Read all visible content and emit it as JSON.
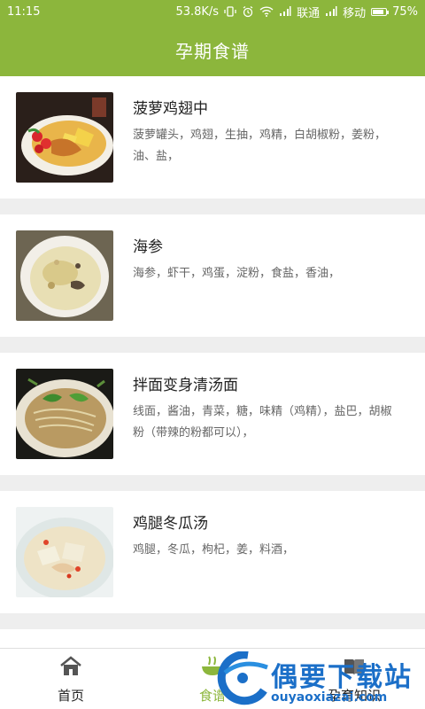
{
  "status": {
    "time": "11:15",
    "speed": "53.8K/s",
    "carrier1": "联通",
    "carrier2": "移动",
    "battery": "75%",
    "battery_level": 0.75
  },
  "header": {
    "title": "孕期食谱"
  },
  "recipes": [
    {
      "title": "菠萝鸡翅中",
      "ingredients": "菠萝罐头，鸡翅，生抽，鸡精，白胡椒粉，姜粉，油、盐，",
      "image": "pineapple-chicken-wings-photo"
    },
    {
      "title": "海参",
      "ingredients": "海参，虾干，鸡蛋，淀粉，食盐，香油，",
      "image": "sea-cucumber-soup-photo"
    },
    {
      "title": "拌面变身清汤面",
      "ingredients": "线面，酱油，青菜，糖，味精（鸡精），盐巴，胡椒粉（带辣的粉都可以），",
      "image": "clear-noodle-soup-photo"
    },
    {
      "title": "鸡腿冬瓜汤",
      "ingredients": "鸡腿，冬瓜，枸杞，姜，料酒，",
      "image": "chicken-winter-melon-soup-photo"
    }
  ],
  "tabs": [
    {
      "label": "首页",
      "icon": "home-icon"
    },
    {
      "label": "食谱",
      "icon": "bowl-icon",
      "active": true
    },
    {
      "label": "孕育知识",
      "icon": "book-icon"
    }
  ],
  "watermark": {
    "text": "偶要下载站",
    "url": "ouyaoxiazai.com"
  },
  "colors": {
    "accent": "#8cb63c",
    "watermark": "#1b6fc8"
  }
}
